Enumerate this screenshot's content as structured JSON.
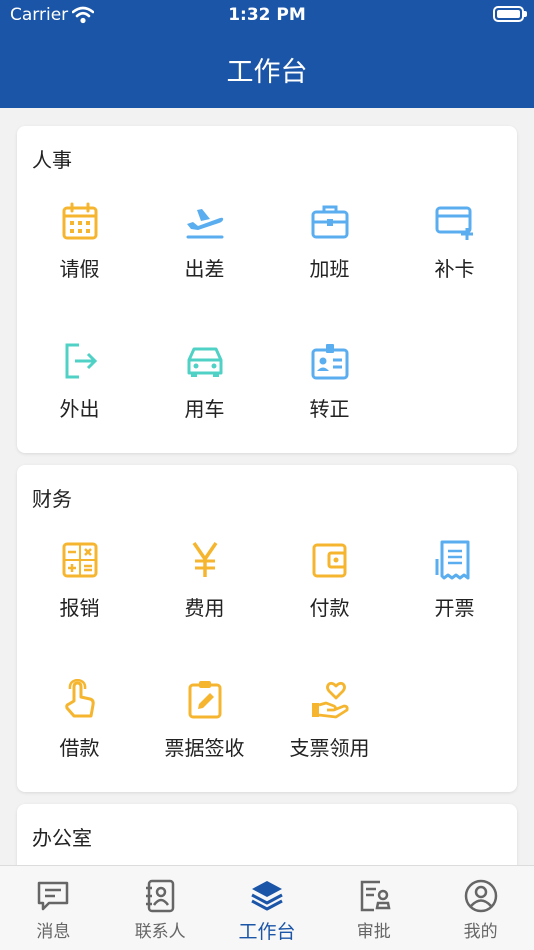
{
  "status_bar": {
    "carrier": "Carrier",
    "time": "1:32 PM"
  },
  "header": {
    "title": "工作台"
  },
  "sections": [
    {
      "title": "人事",
      "items": [
        {
          "label": "请假",
          "icon": "calendar-icon",
          "color": "#f5b52e"
        },
        {
          "label": "出差",
          "icon": "airplane-icon",
          "color": "#5aaef0"
        },
        {
          "label": "加班",
          "icon": "briefcase-icon",
          "color": "#5aaef0"
        },
        {
          "label": "补卡",
          "icon": "card-add-icon",
          "color": "#5aaef0"
        },
        {
          "label": "外出",
          "icon": "exit-icon",
          "color": "#4fd1c5"
        },
        {
          "label": "用车",
          "icon": "car-icon",
          "color": "#4fd1c5"
        },
        {
          "label": "转正",
          "icon": "badge-icon",
          "color": "#5aaef0"
        }
      ]
    },
    {
      "title": "财务",
      "items": [
        {
          "label": "报销",
          "icon": "calculator-icon",
          "color": "#f5b52e"
        },
        {
          "label": "费用",
          "icon": "yen-icon",
          "color": "#f5b52e"
        },
        {
          "label": "付款",
          "icon": "wallet-icon",
          "color": "#f5b52e"
        },
        {
          "label": "开票",
          "icon": "receipt-icon",
          "color": "#5aaef0"
        },
        {
          "label": "借款",
          "icon": "hand-pointer-icon",
          "color": "#f5b52e"
        },
        {
          "label": "票据签收",
          "icon": "clipboard-pen-icon",
          "color": "#f5b52e"
        },
        {
          "label": "支票领用",
          "icon": "hand-heart-icon",
          "color": "#f5b52e"
        }
      ]
    },
    {
      "title": "办公室",
      "items": []
    }
  ],
  "tabs": [
    {
      "label": "消息",
      "icon": "message-icon",
      "active": false
    },
    {
      "label": "联系人",
      "icon": "contacts-icon",
      "active": false
    },
    {
      "label": "工作台",
      "icon": "layers-icon",
      "active": true
    },
    {
      "label": "审批",
      "icon": "approval-icon",
      "active": false
    },
    {
      "label": "我的",
      "icon": "profile-icon",
      "active": false
    }
  ],
  "colors": {
    "brand": "#1b55a8",
    "yellow": "#f5b52e",
    "blue": "#5aaef0",
    "teal": "#4fd1c5",
    "tab_inactive": "#666666"
  }
}
